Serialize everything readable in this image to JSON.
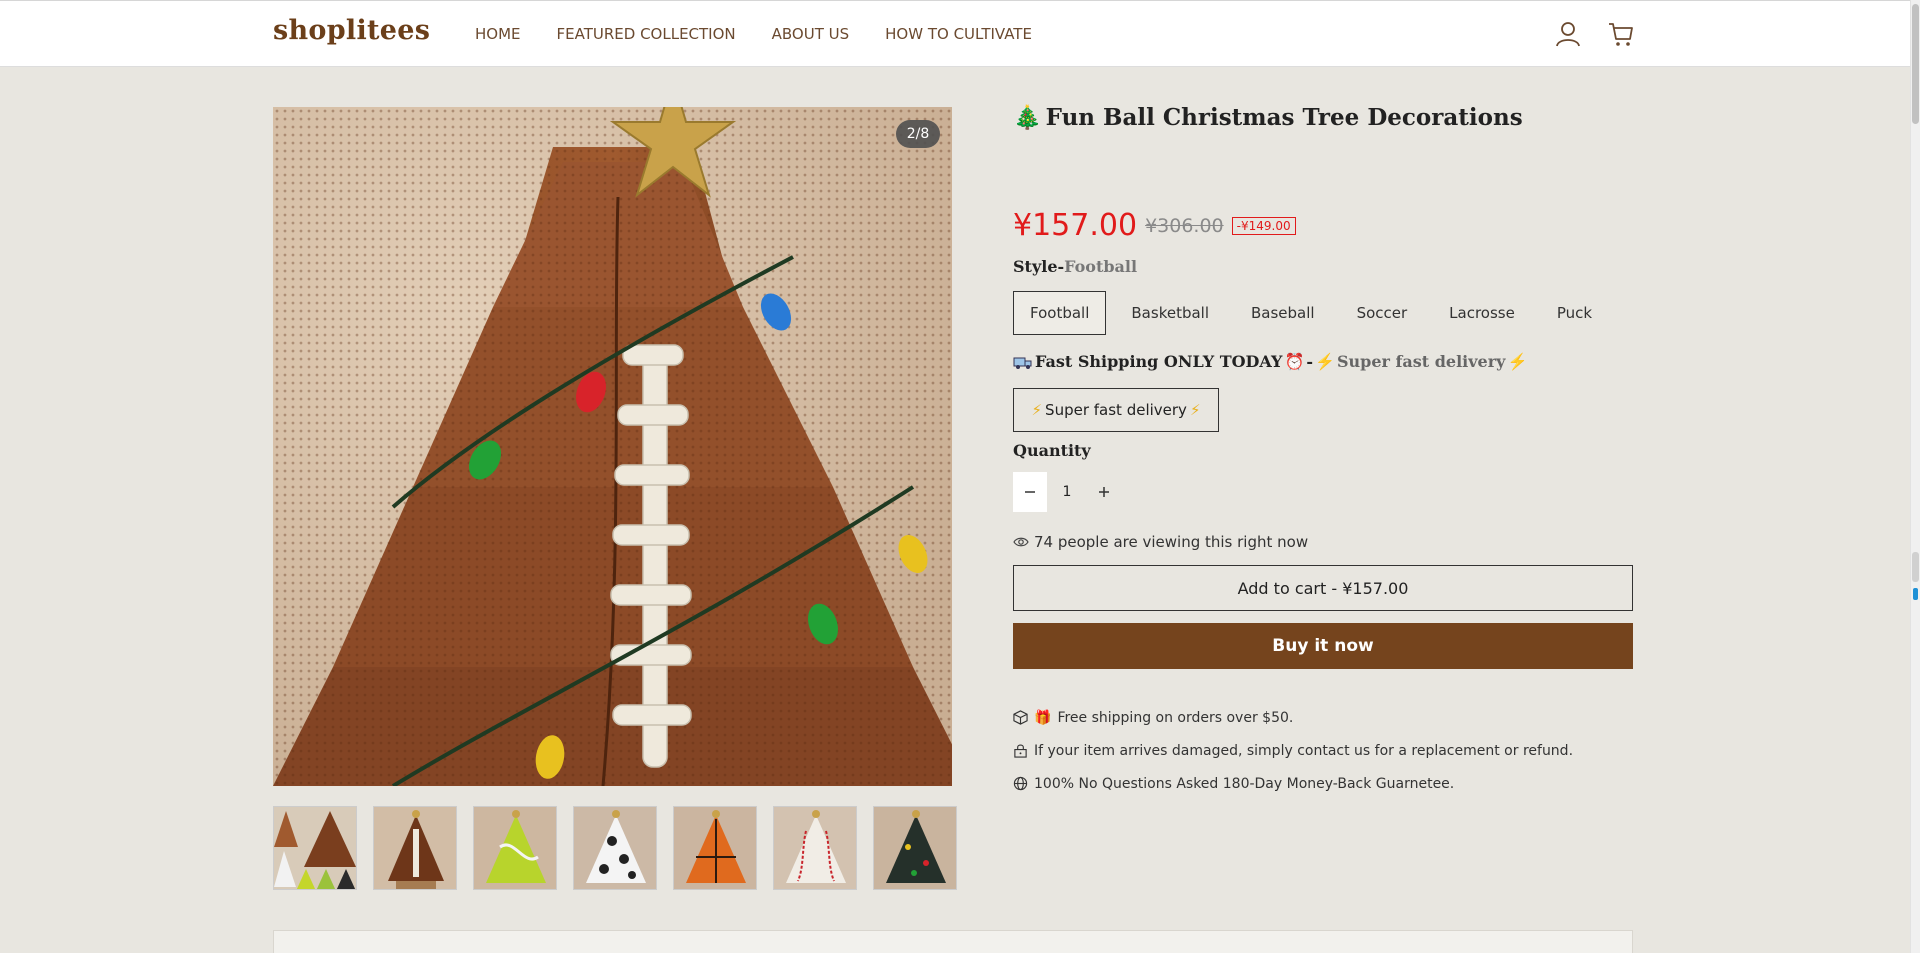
{
  "header": {
    "logo": "shoplitees",
    "nav": [
      "HOME",
      "FEATURED COLLECTION",
      "ABOUT US",
      "HOW TO CULTIVATE"
    ]
  },
  "gallery": {
    "counter": "2/8",
    "thumbnails": [
      "collage",
      "football",
      "tennis",
      "soccer",
      "basketball",
      "baseball",
      "hockey"
    ]
  },
  "product": {
    "title_emoji": "🎄",
    "title": "Fun Ball Christmas Tree Decorations",
    "price": "¥157.00",
    "compare_price": "¥306.00",
    "discount": "-¥149.00",
    "style_label": "Style-",
    "style_value": "Football",
    "options": [
      "Football",
      "Basketball",
      "Baseball",
      "Soccer",
      "Lacrosse",
      "Puck"
    ],
    "shipping_label_prefix": "�among",
    "shipping_label": "Fast Shipping ONLY TODAY",
    "shipping_sep": "-",
    "shipping_value": "Super fast delivery",
    "shipping_option": "Super fast delivery",
    "quantity_label": "Quantity",
    "quantity": "1",
    "viewing": "74 people are viewing this right now",
    "add_to_cart": "Add to cart - ¥157.00",
    "buy_now": "Buy it now",
    "perks": [
      "Free shipping on orders over $50.",
      "If your item arrives damaged, simply contact us for a replacement or refund.",
      "100% No Questions Asked 180-Day Money-Back Guarnetee."
    ]
  },
  "colors": {
    "brand": "#75441d",
    "price": "#e11b1b",
    "background": "#e8e6e0"
  }
}
